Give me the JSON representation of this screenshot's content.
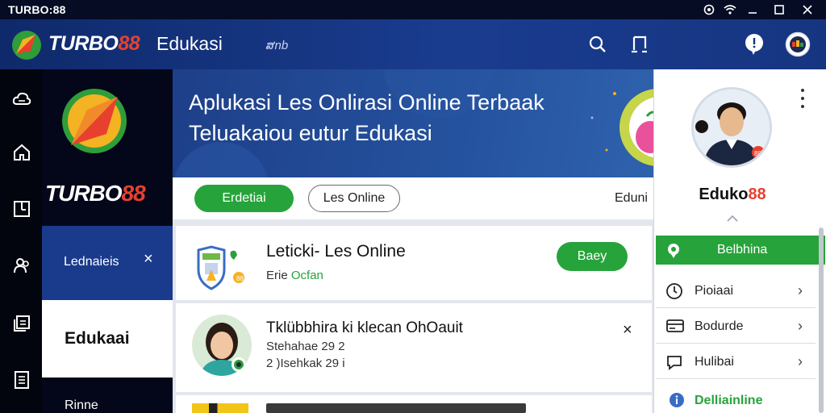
{
  "window": {
    "title": "TURBO:88",
    "controls": [
      "notification-icon",
      "wifi-icon",
      "minimize-icon",
      "maximize-icon",
      "close-icon"
    ]
  },
  "header": {
    "brand_main": "TURBO",
    "brand_accent": "88",
    "title": "Edukasi",
    "subtitle": "ສnb",
    "icons": [
      "search-icon",
      "music-note-icon",
      "chat-bubble-icon",
      "profile-avatar-icon"
    ]
  },
  "rail": {
    "icons": [
      "cloud-icon",
      "home-icon",
      "book-icon",
      "users-icon",
      "document-stack-icon",
      "list-document-icon"
    ]
  },
  "nav": {
    "brand_main": "TURBO",
    "brand_accent": "88",
    "items": [
      {
        "label": "Lednaieis",
        "close": "×"
      },
      {
        "label": "Edukaai"
      },
      {
        "label": "Rinne"
      }
    ]
  },
  "banner": {
    "line1": "Aplukasi Les Onlirasi Online Terbaak",
    "line2": "Teluakaiou eutur Edukasi"
  },
  "tabs": [
    {
      "label": "Erdetiai",
      "active": true
    },
    {
      "label": "Les Online",
      "active": false
    },
    {
      "label": "Eduni",
      "active": false
    }
  ],
  "cards": [
    {
      "title": "Leticki- Les Online",
      "sub_prefix": "Erie",
      "sub_accent": "Ocfan",
      "button": "Baey"
    },
    {
      "title": "Tklübbhira ki klecan OhOauit",
      "line1": "Stehahae 29 2",
      "line2": "2 )Isehkak 29 i",
      "close": "×"
    }
  ],
  "profile": {
    "name_main": "Eduko",
    "name_accent": "88",
    "active_item": "Belbhina",
    "menu": [
      {
        "icon": "clock-icon",
        "label": "Pioiaai",
        "chevron": "›"
      },
      {
        "icon": "card-icon",
        "label": "Bodurde",
        "chevron": "›"
      },
      {
        "icon": "chat-icon",
        "label": "Hulibai",
        "chevron": "›"
      }
    ],
    "last_item": "Delliainline"
  },
  "colors": {
    "primary_blue": "#1a3b8b",
    "accent_green": "#27a33b",
    "brand_red": "#e8402e"
  }
}
